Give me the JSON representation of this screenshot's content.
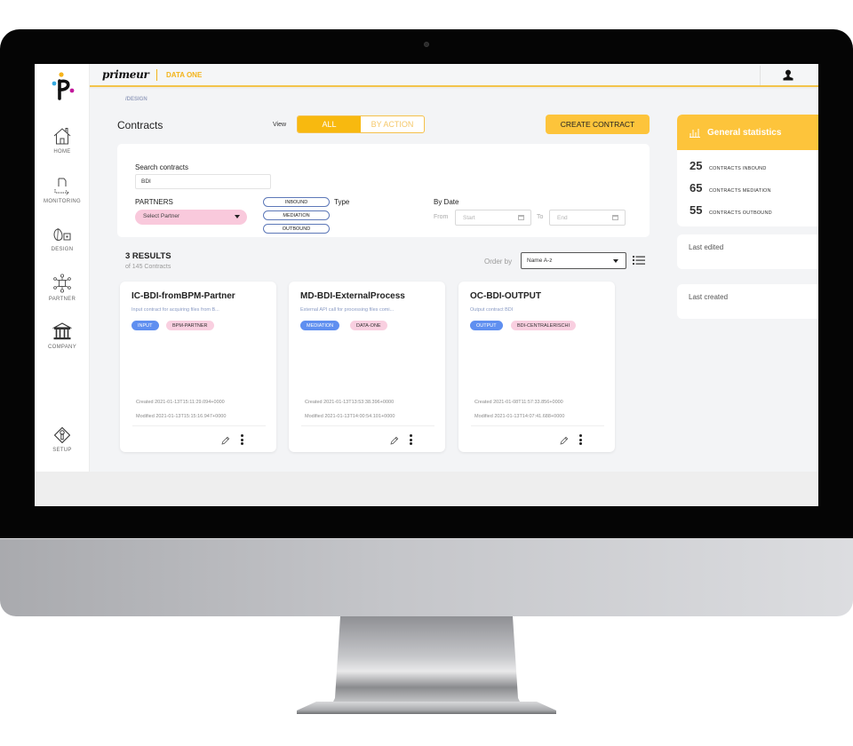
{
  "header": {
    "brand": "primeur",
    "product": "DATA ONE"
  },
  "breadcrumb": "/DESIGN",
  "page_title": "Contracts",
  "view": {
    "label": "View",
    "options": [
      "ALL",
      "BY ACTION"
    ],
    "selected": "ALL"
  },
  "create_button": "CREATE CONTRACT",
  "sidebar": {
    "items": [
      {
        "label": "HOME",
        "icon": "home-icon"
      },
      {
        "label": "MONITORING",
        "icon": "monitoring-icon"
      },
      {
        "label": "DESIGN",
        "icon": "design-icon"
      },
      {
        "label": "PARTNER",
        "icon": "partner-network-icon"
      },
      {
        "label": "COMPANY",
        "icon": "company-building-icon"
      },
      {
        "label": "SETUP",
        "icon": "setup-icon"
      }
    ]
  },
  "filters": {
    "search_label": "Search contracts",
    "search_value": "BDI",
    "partners_label": "PARTNERS",
    "partner_placeholder": "Select Partner",
    "type_label": "Type",
    "type_options": [
      "INBOUND",
      "MEDIATION",
      "OUTBOUND"
    ],
    "date_label": "By Date",
    "from_label": "From",
    "from_placeholder": "Start",
    "to_label": "To",
    "to_placeholder": "End"
  },
  "results": {
    "title": "3 RESULTS",
    "subtitle": "of 145 Contracts",
    "order_label": "Order by",
    "order_value": "Name A-z"
  },
  "cards": [
    {
      "title": "IC-BDI-fromBPM-Partner",
      "description": "Input contract for acquiring files from B...",
      "type_tag": "INPUT",
      "partner_tag": "BPM-PARTNER",
      "created": "Created 2021-01-13T15:11:29.094+0000",
      "modified": "Modified 2021-01-13T15:15:16.947+0000"
    },
    {
      "title": "MD-BDI-ExternalProcess",
      "description": "External API call for processing files comi...",
      "type_tag": "MEDIATION",
      "partner_tag": "DATA-ONE",
      "created": "Created 2021-01-13T13:53:38.396+0000",
      "modified": "Modified 2021-01-13T14:00:54.101+0000"
    },
    {
      "title": "OC-BDI-OUTPUT",
      "description": "Output contract BDI",
      "type_tag": "OUTPUT",
      "partner_tag": "BDI-CENTRALERISCHI",
      "created": "Created 2021-01-08T11:57:33.856+0000",
      "modified": "Modified 2021-01-13T14:07:41.688+0000"
    }
  ],
  "stats": {
    "title": "General statistics",
    "rows": [
      {
        "value": "25",
        "label": "CONTRACTS INBOUND"
      },
      {
        "value": "65",
        "label": "CONTRACTS MEDIATION"
      },
      {
        "value": "55",
        "label": "CONTRACTS OUTBOUND"
      }
    ]
  },
  "last_edited": "Last edited",
  "last_created": "Last created",
  "colors": {
    "accent": "#fdc43b",
    "accent_dark": "#f8b90f",
    "type_tag": "#5f8ff0",
    "partner_tag": "#f9cfe0",
    "partner_select": "#f9c9dc"
  }
}
